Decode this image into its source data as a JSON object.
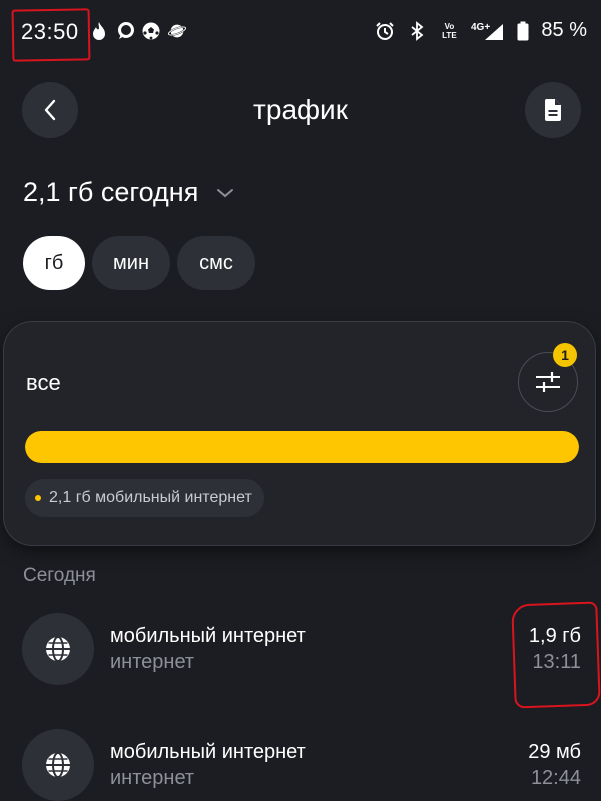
{
  "status_bar": {
    "time": "23:50",
    "battery_percent": "85 %",
    "network": "4G+",
    "volte": "Vo\nLTE",
    "icons_left": [
      "flame-icon",
      "chat-bubble-icon",
      "soccer-ball-icon",
      "planet-icon"
    ],
    "icons_right": [
      "alarm-icon",
      "bluetooth-icon",
      "volte-icon",
      "signal-icon",
      "battery-icon"
    ]
  },
  "header": {
    "title": "трафик",
    "back_icon": "chevron-left-icon",
    "doc_icon": "document-icon"
  },
  "period": {
    "label": "2,1 гб сегодня",
    "icon": "chevron-down-icon"
  },
  "unit_chips": [
    {
      "label": "гб",
      "active": true
    },
    {
      "label": "мин",
      "active": false
    },
    {
      "label": "смс",
      "active": false
    }
  ],
  "usage_card": {
    "title": "все",
    "filter_icon": "sliders-icon",
    "filter_badge": "1",
    "bar_fill_fraction": 1.0,
    "legend_label": "2,1 гб мобильный интернет",
    "accent_color": "#fdc601"
  },
  "history": {
    "section_label": "Сегодня",
    "items": [
      {
        "title": "мобильный интернет",
        "subtitle": "интернет",
        "amount": "1,9 гб",
        "time": "13:11",
        "icon": "globe-icon"
      },
      {
        "title": "мобильный интернет",
        "subtitle": "интернет",
        "amount": "29 мб",
        "time": "12:44",
        "icon": "globe-icon"
      }
    ]
  }
}
